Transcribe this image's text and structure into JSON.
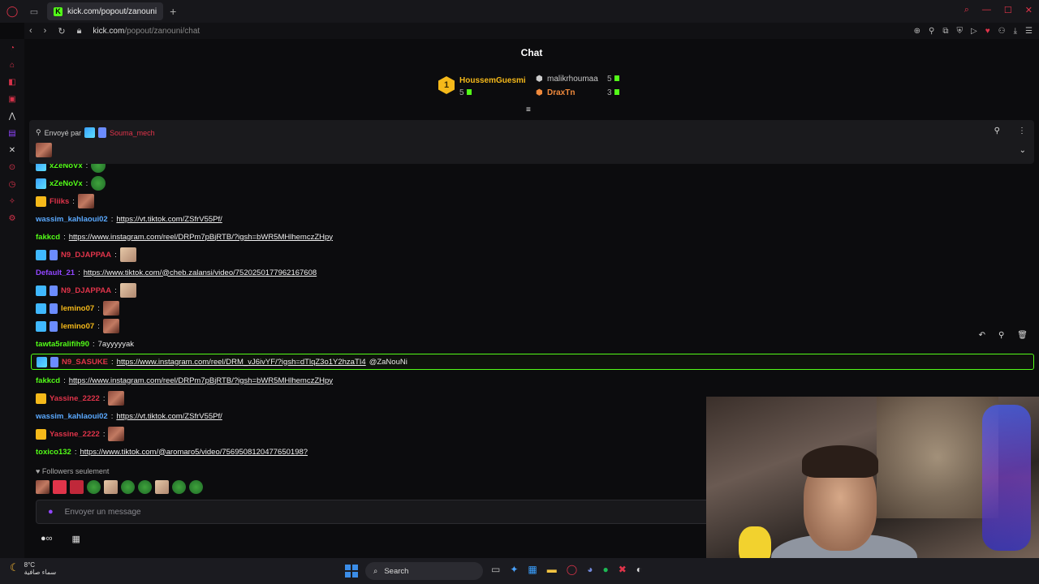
{
  "browser": {
    "tab_title": "kick.com/popout/zanouni",
    "url_host": "kick.com",
    "url_path": "/popout/zanouni/chat"
  },
  "chat": {
    "title": "Chat",
    "leaderboard": [
      {
        "name": "HoussemGuesmi",
        "count": "5",
        "color": "#f5b91a"
      },
      {
        "name": "malikrhoumaa",
        "count": "5",
        "color": "#c8c8c8"
      },
      {
        "name": "DraxTn",
        "count": "3",
        "color": "#f08a3c"
      }
    ],
    "pinned": {
      "sent_by": "Envoyé par",
      "user": "Souma_mech"
    },
    "messages": [
      {
        "user": "xZeNoVx",
        "color": "#53fc18",
        "text": "",
        "sep": ":"
      },
      {
        "user": "xZeNoVx",
        "color": "#53fc18",
        "text": "",
        "sep": ":"
      },
      {
        "user": "Fliiks",
        "color": "#e0344a",
        "text": "",
        "sep": ":"
      },
      {
        "user": "wassim_kahlaoui02",
        "color": "#5aa9ff",
        "text": "https://vt.tiktok.com/ZSfrV55Pf/",
        "sep": ":"
      },
      {
        "user": "fakkcd",
        "color": "#53fc18",
        "text": "https://www.instagram.com/reel/DRPm7pBjRTB/?igsh=bWR5MHlhemczZHpy",
        "sep": ":"
      },
      {
        "user": "N9_DJAPPAA",
        "color": "#e0344a",
        "text": "",
        "sep": ":"
      },
      {
        "user": "Default_21",
        "color": "#9146ff",
        "text": "https://www.tiktok.com/@cheb.zalansi/video/7520250177962167608",
        "sep": ":"
      },
      {
        "user": "N9_DJAPPAA",
        "color": "#e0344a",
        "text": "",
        "sep": ":"
      },
      {
        "user": "lemino07",
        "color": "#f5b91a",
        "text": "",
        "sep": ":"
      },
      {
        "user": "lemino07",
        "color": "#f5b91a",
        "text": "",
        "sep": ":"
      },
      {
        "user": "tawta5ralifih90",
        "color": "#53fc18",
        "text": "7ayyyyyak",
        "sep": ":"
      },
      {
        "user": "N9_SASUKE",
        "color": "#e0344a",
        "text": "https://www.instagram.com/reel/DRM_vJ6ivYF/?igsh=dTlqZ3o1Y2hzaTI4",
        "mention": "@ZaNouNi",
        "sep": ":"
      },
      {
        "user": "fakkcd",
        "color": "#53fc18",
        "text": "https://www.instagram.com/reel/DRPm7pBjRTB/?igsh=bWR5MHlhemczZHpy",
        "sep": ":"
      },
      {
        "user": "Yassine_2222",
        "color": "#e0344a",
        "text": "",
        "sep": ":"
      },
      {
        "user": "wassim_kahlaoui02",
        "color": "#5aa9ff",
        "text": "https://vt.tiktok.com/ZSfrV55Pf/",
        "sep": ":"
      },
      {
        "user": "Yassine_2222",
        "color": "#e0344a",
        "text": "",
        "sep": ":"
      },
      {
        "user": "toxico132",
        "color": "#53fc18",
        "text": "https://www.tiktok.com/@aromaro5/video/7569508120477650198?",
        "sep": ":"
      }
    ],
    "followers_only": "Followers seulement",
    "input_placeholder": "Envoyer un message"
  },
  "taskbar": {
    "temp": "8°C",
    "weather_desc": "سماء صافية",
    "search_label": "Search"
  },
  "colors": {
    "accent": "#53fc18",
    "opera": "#e0344a"
  }
}
